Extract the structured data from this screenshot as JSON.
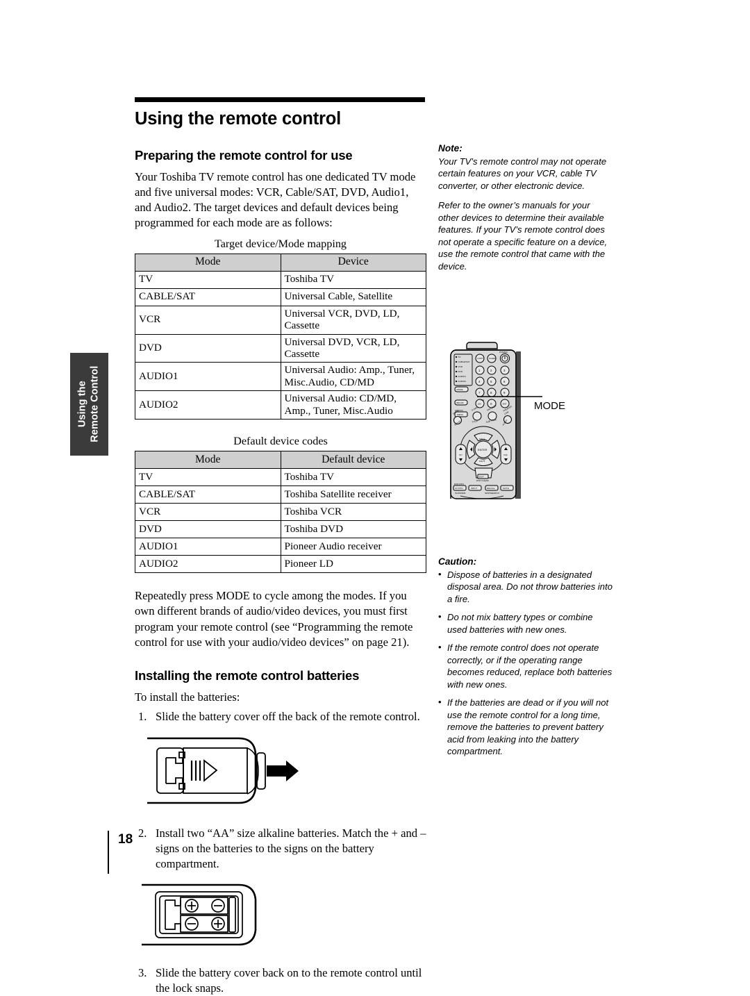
{
  "page": {
    "title": "Using the remote control",
    "number": "18",
    "side_tab_line1": "Using the",
    "side_tab_line2": "Remote Control"
  },
  "sections": {
    "preparing": {
      "heading": "Preparing the remote control for use",
      "intro": "Your Toshiba TV remote control has one dedicated TV mode and five universal modes: VCR, Cable/SAT, DVD, Audio1, and Audio2. The target devices and default devices being programmed for each mode are as follows:",
      "after_tables": "Repeatedly press MODE to cycle among the modes. If you own different brands of audio/video devices, you must first program your remote control (see “Programming the remote control for use with your audio/video devices” on page 21)."
    },
    "installing": {
      "heading": "Installing the remote control batteries",
      "intro": "To install the batteries:",
      "steps": [
        {
          "num": "1.",
          "text": "Slide the battery cover off the back of the remote control."
        },
        {
          "num": "2.",
          "text": "Install two “AA” size alkaline batteries. Match the + and – signs on the batteries to the signs on the battery compartment."
        },
        {
          "num": "3.",
          "text": "Slide the battery cover back on to the remote control until the lock snaps."
        }
      ]
    }
  },
  "tables": [
    {
      "caption": "Target device/Mode mapping",
      "headers": [
        "Mode",
        "Device"
      ],
      "rows": [
        [
          "TV",
          "Toshiba TV"
        ],
        [
          "CABLE/SAT",
          "Universal Cable, Satellite"
        ],
        [
          "VCR",
          "Universal VCR, DVD, LD, Cassette"
        ],
        [
          "DVD",
          "Universal DVD, VCR, LD, Cassette"
        ],
        [
          "AUDIO1",
          "Universal Audio: Amp., Tuner, Misc.Audio, CD/MD"
        ],
        [
          "AUDIO2",
          "Universal Audio: CD/MD, Amp., Tuner, Misc.Audio"
        ]
      ]
    },
    {
      "caption": "Default device codes",
      "headers": [
        "Mode",
        "Default device"
      ],
      "rows": [
        [
          "TV",
          "Toshiba TV"
        ],
        [
          "CABLE/SAT",
          "Toshiba Satellite receiver"
        ],
        [
          "VCR",
          "Toshiba VCR"
        ],
        [
          "DVD",
          "Toshiba  DVD"
        ],
        [
          "AUDIO1",
          "Pioneer Audio receiver"
        ],
        [
          "AUDIO2",
          "Pioneer LD"
        ]
      ]
    }
  ],
  "sidebar": {
    "note": {
      "heading": "Note:",
      "paragraphs": [
        "Your TV’s remote control may not operate certain features on your VCR, cable TV converter, or other electronic device.",
        "Refer to the owner’s manuals for your other devices to determine their available features. If your TV’s remote control does not operate a specific feature on a device, use the remote control that came with the device."
      ]
    },
    "caution": {
      "heading": "Caution:",
      "bullet": "•",
      "items": [
        "Dispose of batteries in a designated disposal area. Do not throw batteries into a fire.",
        "Do not mix battery types or combine used batteries with new ones.",
        "If the remote control does not operate correctly, or if the operating range becomes reduced, replace both batteries with new ones.",
        "If the batteries are dead or if you will not use the remote control for a long time, remove the batteries to prevent battery acid from leaking into the battery compartment."
      ]
    },
    "mode_callout": "MODE"
  },
  "remote_diagram": {
    "mode_list": [
      "TV",
      "CABLE/SAT",
      "VCR",
      "DVD",
      "AUDIO1",
      "AUDIO2"
    ],
    "mode_button": "MODE",
    "rec_button": "REC/IR",
    "action_label": "ACTION",
    "menu_button": "MENU",
    "power_label": "POWER",
    "light_button": "LIGHT",
    "sleep_button": "SLEEP",
    "keypad": [
      "1",
      "2",
      "3",
      "4",
      "5",
      "6",
      "7",
      "8",
      "9",
      "100",
      "0",
      "ENT"
    ],
    "enter_button": "ENTER",
    "fav_up": "FAV▲",
    "fav_down": "FAV▼",
    "ch_label": "CH",
    "vol_label": "VOL",
    "exit_button": "EXIT",
    "dvd_clear": "DVD CLEAR",
    "info_button": "P-INFO",
    "favorite_button": "FAVORITE",
    "theater_link": "THEATER LINK",
    "guide_button": "GUIDE",
    "setup_button": "SETUP",
    "title_button": "TITLE",
    "sub_title_button": "SUB TITLE",
    "audio_button": "AUDIO",
    "bottom_row": [
      "CH RTN",
      "INPUT",
      "RECALL",
      "MUTE"
    ],
    "bottom_upper": [
      "DVD RTN",
      "",
      "",
      ""
    ],
    "bottom_lower": [
      "SLOW/DIR",
      "SKIP/SEARCH"
    ]
  }
}
